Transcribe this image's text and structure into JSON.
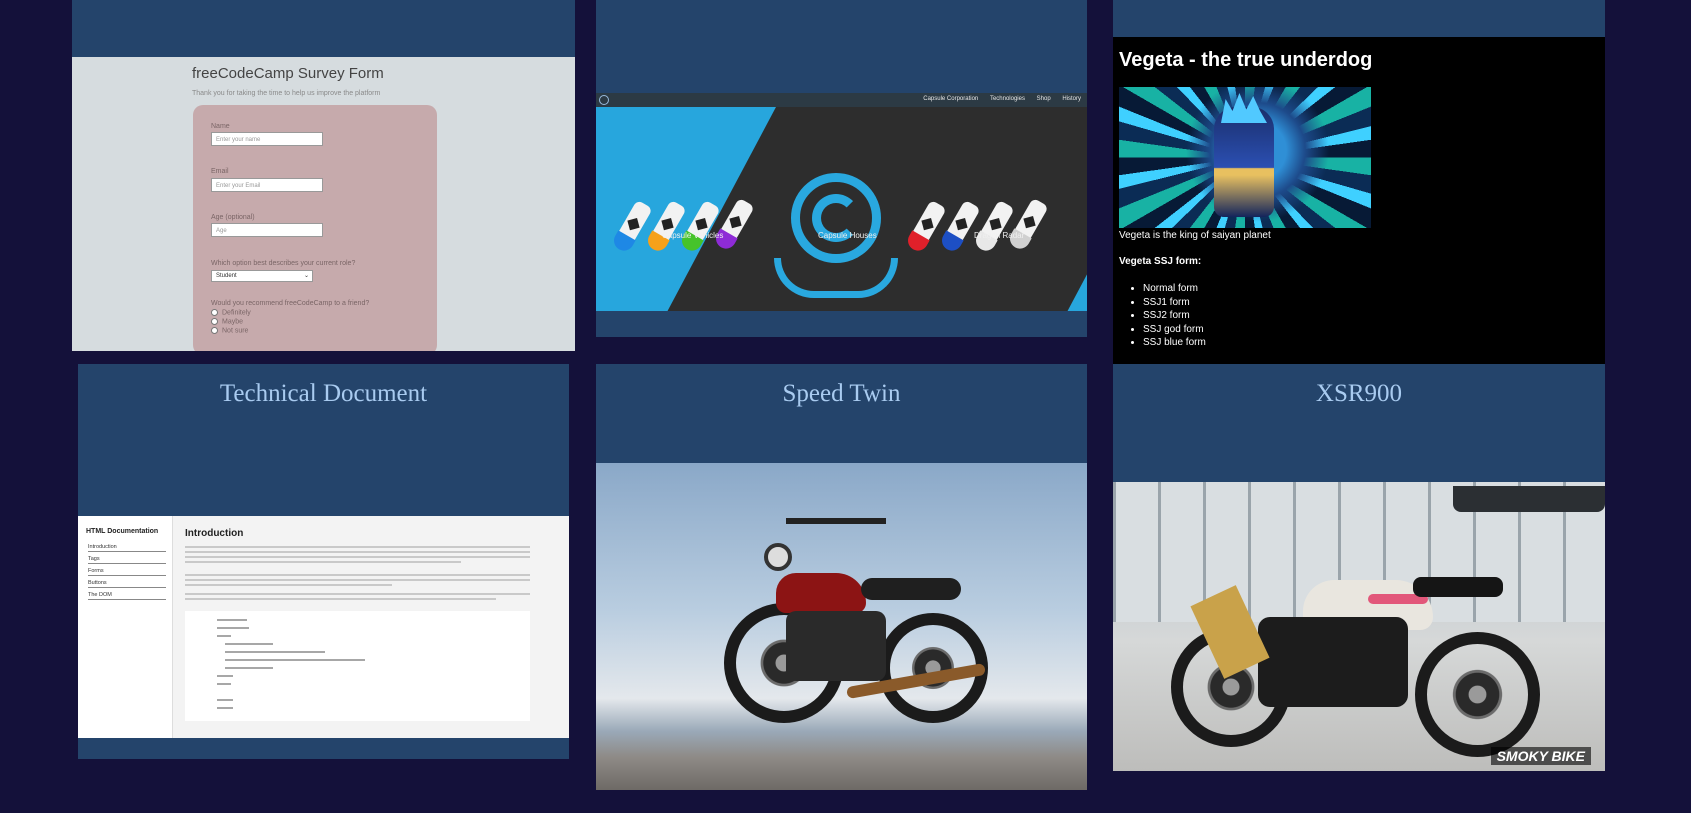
{
  "cards": [
    {
      "title": "",
      "survey": {
        "title": "freeCodeCamp Survey Form",
        "subtitle": "Thank you for taking the time to help us improve the platform",
        "name_label": "Name",
        "name_placeholder": "Enter your name",
        "email_label": "Email",
        "email_placeholder": "Enter your Email",
        "age_label": "Age (optional)",
        "age_placeholder": "Age",
        "role_question": "Which option best describes your current role?",
        "role_selected": "Student",
        "recommend_question": "Would you recommend freeCodeCamp to a friend?",
        "options": [
          "Definitely",
          "Maybe",
          "Not sure"
        ]
      }
    },
    {
      "title": "",
      "capsule": {
        "nav_links": [
          "Capsule Corporation",
          "Technologies",
          "Shop",
          "History"
        ],
        "labels": [
          "Capsule Vehicles",
          "Capsule Houses",
          "Dragon Radar"
        ]
      }
    },
    {
      "title": "",
      "vegeta": {
        "heading": "Vegeta - the true underdog",
        "caption": "Vegeta is the king of saiyan planet",
        "forms_heading": "Vegeta SSJ form:",
        "forms": [
          "Normal form",
          "SSJ1 form",
          "SSJ2 form",
          "SSJ god form",
          "SSJ blue form"
        ]
      }
    },
    {
      "title": "Technical Document",
      "techdoc": {
        "sidebar_heading": "HTML Documentation",
        "sidebar_items": [
          "Introduction",
          "Tags",
          "Forms",
          "Buttons",
          "The DOM"
        ],
        "main_heading": "Introduction"
      }
    },
    {
      "title": "Speed Twin"
    },
    {
      "title": "XSR900",
      "watermark": "SMOKY BIKE"
    }
  ],
  "colors": {
    "page_bg": "#14113a",
    "card_bg": "#24446b",
    "title_color": "#a9cbf0"
  }
}
